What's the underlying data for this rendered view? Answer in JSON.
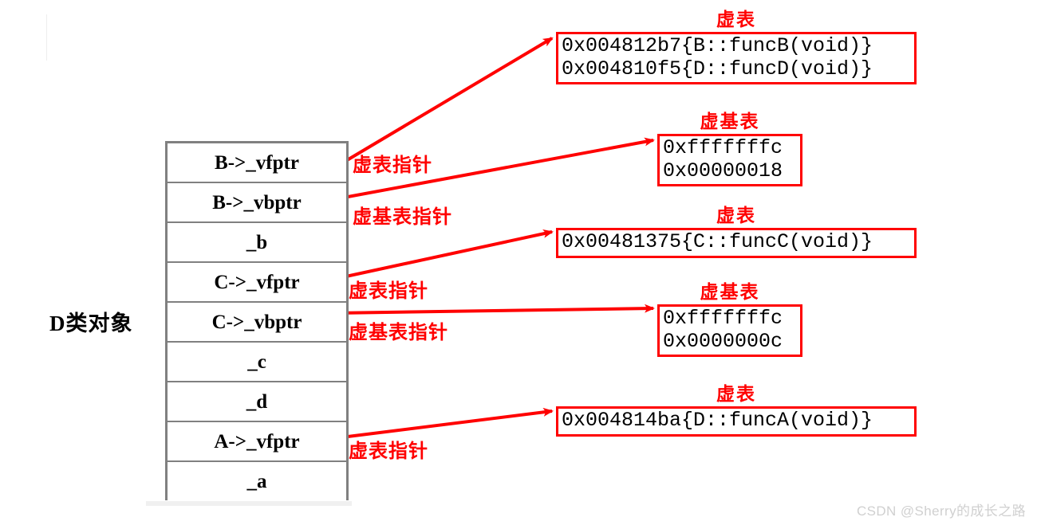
{
  "diagram": {
    "object_label": "D类对象",
    "watermark": "CSDN @Sherry的成长之路",
    "object_rows": [
      {
        "label": "B->_vfptr"
      },
      {
        "label": "B->_vbptr"
      },
      {
        "label": "_b"
      },
      {
        "label": "C->_vfptr"
      },
      {
        "label": "C->_vbptr"
      },
      {
        "label": "_c"
      },
      {
        "label": "_d"
      },
      {
        "label": "A->_vfptr"
      },
      {
        "label": "_a"
      }
    ],
    "pointer_labels": [
      {
        "text": "虚表指针"
      },
      {
        "text": "虚基表指针"
      },
      {
        "text": "虚表指针"
      },
      {
        "text": "虚基表指针"
      },
      {
        "text": "虚表指针"
      }
    ],
    "tables": [
      {
        "title": "虚表",
        "entries": [
          "0x004812b7{B::funcB(void)}",
          "0x004810f5{D::funcD(void)}"
        ]
      },
      {
        "title": "虚基表",
        "entries": [
          "0xfffffffc",
          "0x00000018"
        ]
      },
      {
        "title": "虚表",
        "entries": [
          "0x00481375{C::funcC(void)}"
        ]
      },
      {
        "title": "虚基表",
        "entries": [
          "0xfffffffc",
          "0x0000000c"
        ]
      },
      {
        "title": "虚表",
        "entries": [
          "0x004814ba{D::funcA(void)}"
        ]
      }
    ],
    "colors": {
      "annotation_red": "#ff0000",
      "table_border_gray": "#808080",
      "text_black": "#000000",
      "watermark_gray": "#d0d0d0",
      "background": "#ffffff"
    }
  }
}
